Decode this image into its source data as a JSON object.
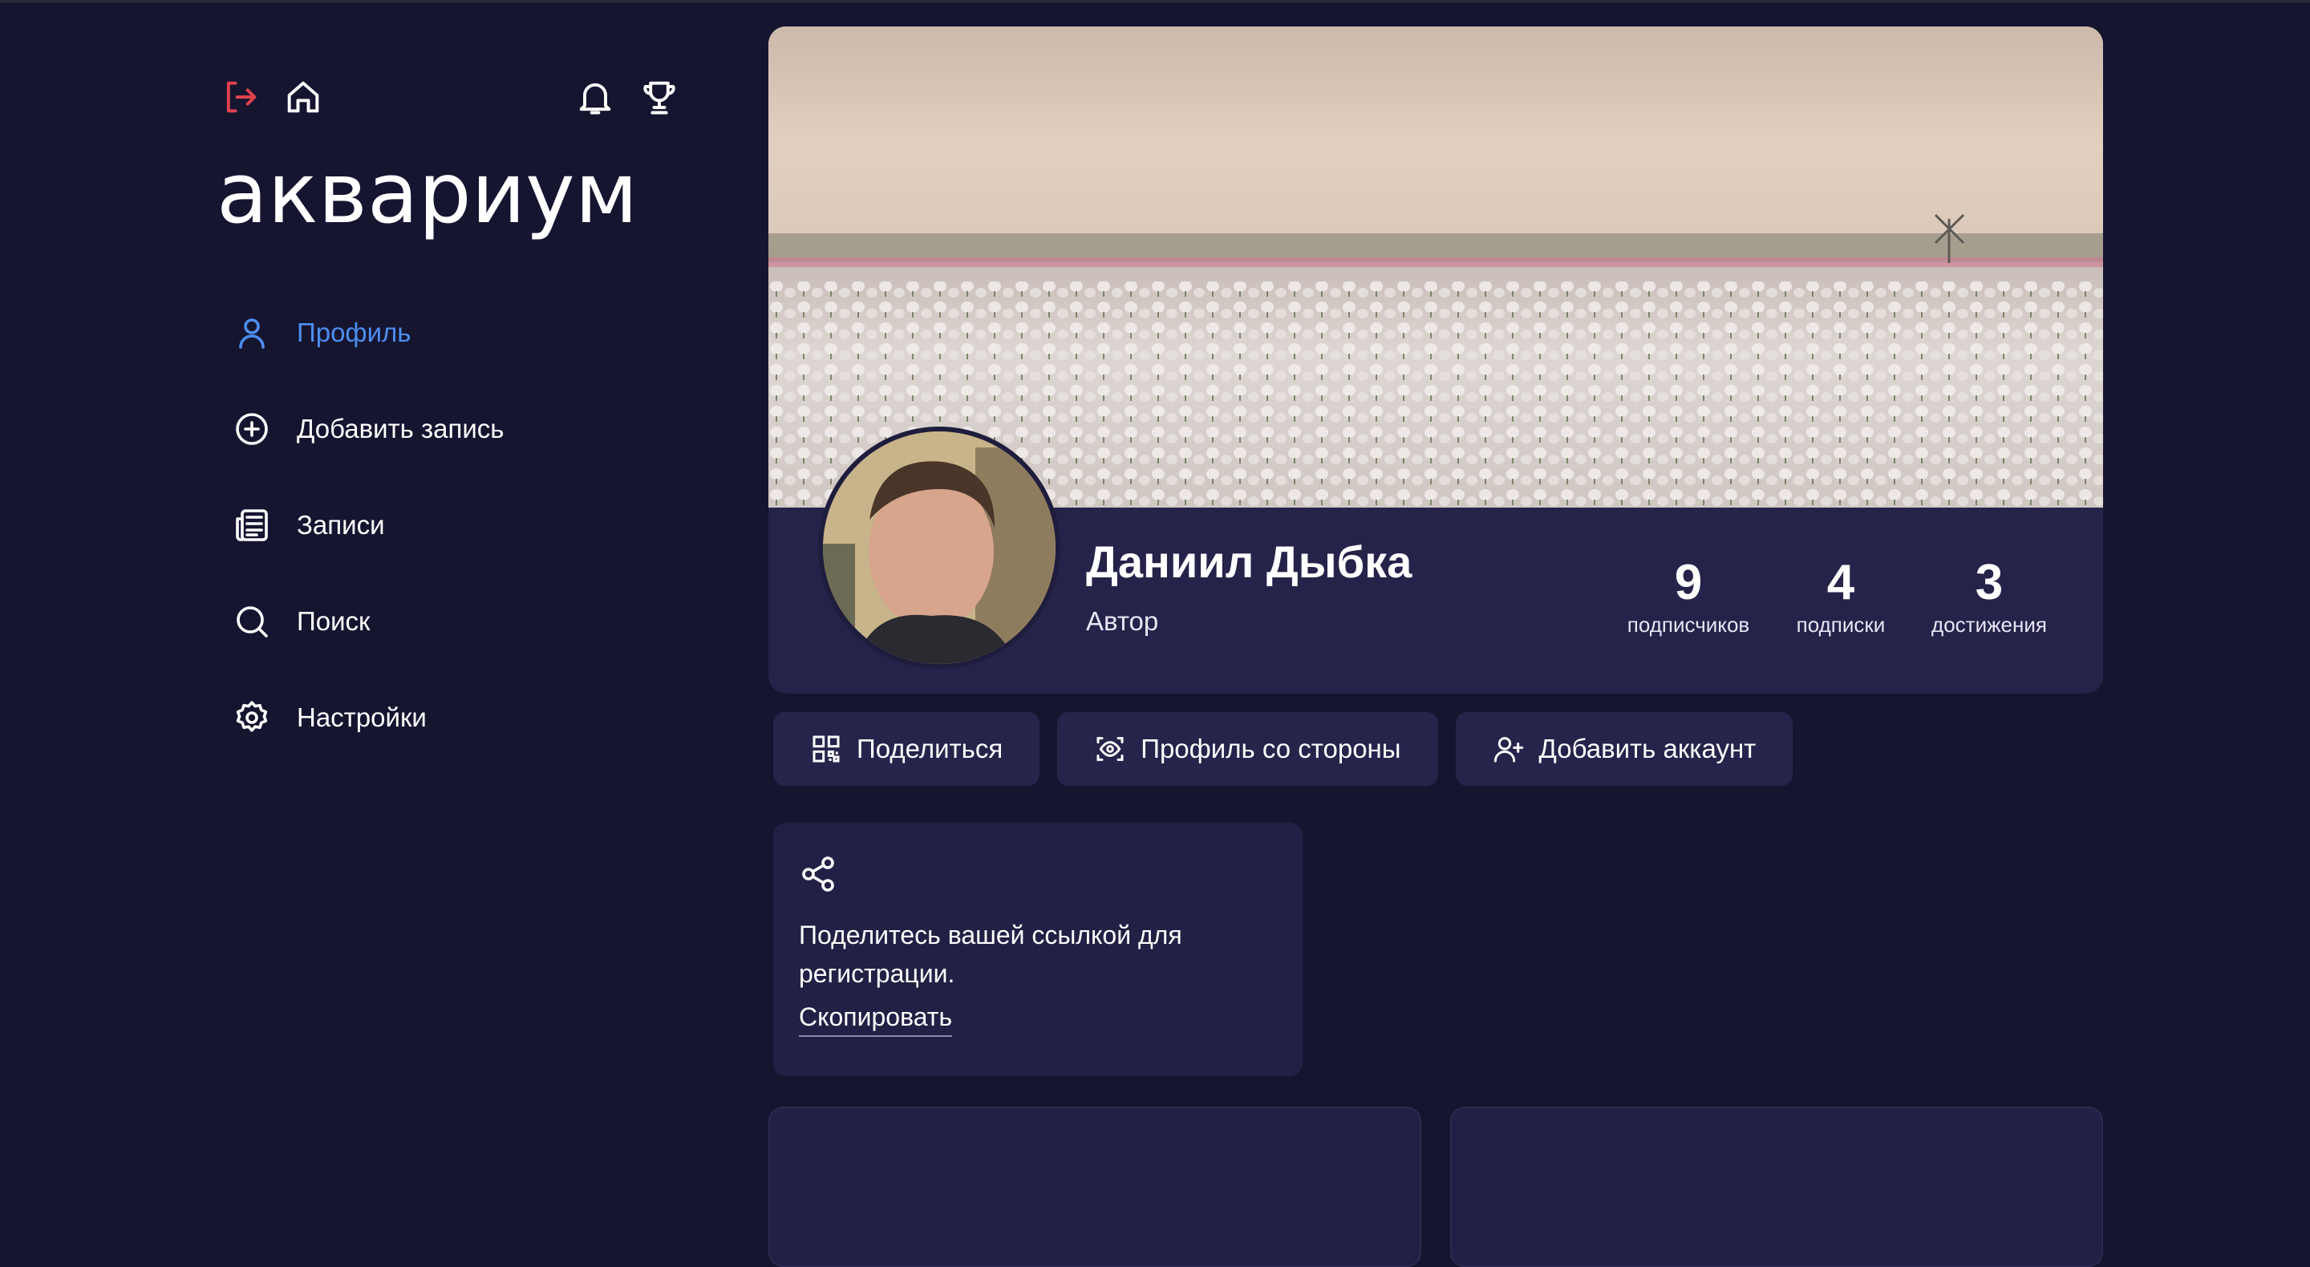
{
  "app": {
    "logo_text": "аквариум",
    "top_icons": [
      "logout-icon",
      "home-icon",
      "bell-icon",
      "trophy-icon"
    ]
  },
  "sidebar": {
    "items": [
      {
        "label": "Профиль",
        "icon": "user-icon",
        "active": true
      },
      {
        "label": "Добавить запись",
        "icon": "plus-circle-icon",
        "active": false
      },
      {
        "label": "Записи",
        "icon": "newspaper-icon",
        "active": false
      },
      {
        "label": "Поиск",
        "icon": "search-icon",
        "active": false
      },
      {
        "label": "Настройки",
        "icon": "gear-icon",
        "active": false
      }
    ]
  },
  "profile": {
    "name": "Даниил Дыбка",
    "role": "Автор",
    "stats": [
      {
        "value": "9",
        "label": "подписчиков"
      },
      {
        "value": "4",
        "label": "подписки"
      },
      {
        "value": "3",
        "label": "достижения"
      }
    ]
  },
  "actions": [
    {
      "label": "Поделиться",
      "icon": "qr-code-icon"
    },
    {
      "label": "Профиль со стороны",
      "icon": "eye-scan-icon"
    },
    {
      "label": "Добавить аккаунт",
      "icon": "user-plus-icon"
    }
  ],
  "share_card": {
    "icon": "share-icon",
    "text": "Поделитесь вашей ссылкой для регистрации.",
    "link_label": "Скопировать"
  },
  "colors": {
    "background": "#161530",
    "card": "#25234a",
    "accent": "#4d8ef0",
    "logout": "#e0424c"
  }
}
